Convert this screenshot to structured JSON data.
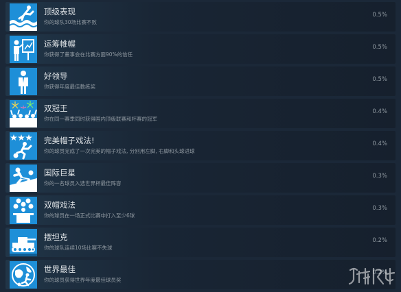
{
  "achievements": [
    {
      "title": "顶级表现",
      "desc": "你的球队30场比赛不败",
      "pct": "0.5%",
      "icon": "swimmer-waves-icon"
    },
    {
      "title": "运筹帷幄",
      "desc": "你获得了董事会在比赛方面90%的信任",
      "pct": "0.5%",
      "icon": "presenter-board-icon"
    },
    {
      "title": "好领导",
      "desc": "你获得年度最佳教练奖",
      "pct": "0.5%",
      "icon": "suited-manager-icon"
    },
    {
      "title": "双冠王",
      "desc": "你在同一赛季同时获得国内顶级联赛和杯赛的冠军",
      "pct": "0.4%",
      "icon": "fireworks-crowd-icon"
    },
    {
      "title": "完美帽子戏法!",
      "desc": "你的球员完成了一次完美的帽子戏法, 分别用左脚, 右脚和头球进球",
      "pct": "0.4%",
      "icon": "three-stars-player-icon"
    },
    {
      "title": "国际巨星",
      "desc": "你的一名球员入选世界杯最佳阵容",
      "pct": "0.3%",
      "icon": "sliding-player-icon"
    },
    {
      "title": "双帽戏法",
      "desc": "你的球员在一场正式比赛中打入至少6球",
      "pct": "0.3%",
      "icon": "magic-hat-icon"
    },
    {
      "title": "摆坦克",
      "desc": "你的球队连续10场比赛不失球",
      "pct": "0.2%",
      "icon": "tank-icon"
    },
    {
      "title": "世界最佳",
      "desc": "你的球员获得世界年度最佳球员奖",
      "pct": "0.2%",
      "icon": "globe-player-icon"
    }
  ]
}
